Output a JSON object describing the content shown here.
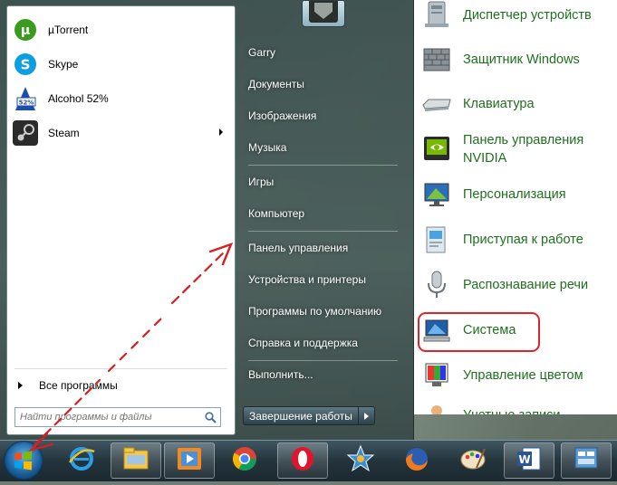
{
  "start_menu": {
    "pinned": [
      {
        "label": "µTorrent",
        "icon": "utorrent-icon"
      },
      {
        "label": "Skype",
        "icon": "skype-icon"
      },
      {
        "label": "Alcohol 52%",
        "icon": "alcohol-icon"
      },
      {
        "label": "Steam",
        "icon": "steam-icon",
        "has_submenu": true
      }
    ],
    "all_programs": "Все программы",
    "search_placeholder": "Найти программы и файлы",
    "right": {
      "items": [
        "Garry",
        "Документы",
        "Изображения",
        "Музыка",
        "Игры",
        "Компьютер",
        "Панель управления",
        "Устройства и принтеры",
        "Программы по умолчанию",
        "Справка и поддержка",
        "Выполнить..."
      ]
    },
    "shutdown_label": "Завершение работы"
  },
  "control_panel": {
    "items": [
      {
        "label": "Диспетчер устройств",
        "icon": "device-manager-icon"
      },
      {
        "label": "Защитник Windows",
        "icon": "windows-defender-icon"
      },
      {
        "label": "Клавиатура",
        "icon": "keyboard-icon"
      },
      {
        "label": "Панель управления NVIDIA",
        "icon": "nvidia-icon"
      },
      {
        "label": "Персонализация",
        "icon": "personalization-icon"
      },
      {
        "label": "Приступая к работе",
        "icon": "getting-started-icon"
      },
      {
        "label": "Распознавание речи",
        "icon": "microphone-icon"
      },
      {
        "label": "Система",
        "icon": "system-icon",
        "highlighted": true
      },
      {
        "label": "Управление цветом",
        "icon": "color-management-icon"
      },
      {
        "label": "Учетные записи",
        "icon": "user-accounts-icon"
      }
    ]
  },
  "taskbar": {
    "buttons": [
      {
        "name": "internet-explorer",
        "icon": "ie-icon"
      },
      {
        "name": "explorer",
        "icon": "folder-icon"
      },
      {
        "name": "media-player",
        "icon": "media-player-icon"
      },
      {
        "name": "chrome",
        "icon": "chrome-icon"
      },
      {
        "name": "opera",
        "icon": "opera-icon"
      },
      {
        "name": "app-star",
        "icon": "star-app-icon"
      },
      {
        "name": "firefox",
        "icon": "firefox-icon"
      },
      {
        "name": "paint",
        "icon": "paint-icon"
      },
      {
        "name": "word",
        "icon": "word-icon"
      },
      {
        "name": "control-panel",
        "icon": "control-panel-icon"
      }
    ]
  },
  "colors": {
    "annotation": "#e2232a",
    "control_panel_text": "#1e6f1e"
  }
}
